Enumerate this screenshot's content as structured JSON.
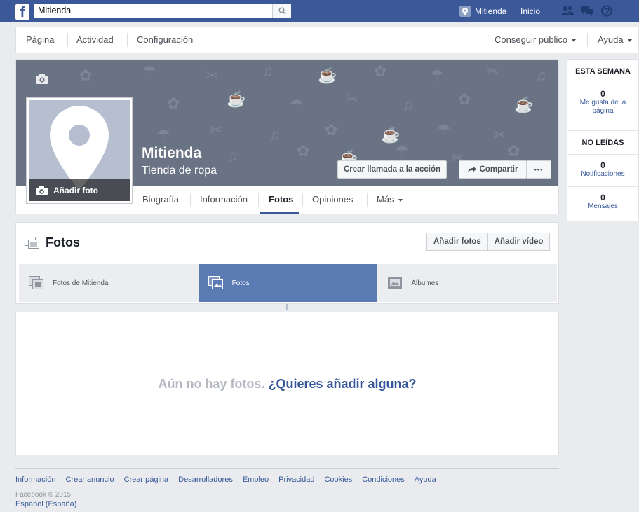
{
  "topbar": {
    "logo": "f",
    "search_value": "Mitienda",
    "page_link": "Mitienda",
    "home": "Inicio",
    "icons": [
      "friends-icon",
      "messages-icon",
      "globe-icon"
    ]
  },
  "pagenav": {
    "left": [
      "Página",
      "Actividad",
      "Configuración"
    ],
    "audience": "Conseguir público",
    "help": "Ayuda"
  },
  "cover": {
    "name": "Mitienda",
    "category": "Tienda de ropa",
    "add_photo": "Añadir foto",
    "cta_button": "Crear llamada a la acción",
    "share_button": "Compartir",
    "more_dots": "•••"
  },
  "tabs": [
    "Biografía",
    "Información",
    "Fotos",
    "Opiniones",
    "Más"
  ],
  "active_tab": "Fotos",
  "rightcol": {
    "week_header": "ESTA SEMANA",
    "likes_count": "0",
    "likes_label": "Me gusta de la página",
    "unread_header": "NO LEÍDAS",
    "notif_count": "0",
    "notif_label": "Notificaciones",
    "msg_count": "0",
    "msg_label": "Mensajes"
  },
  "photos": {
    "title": "Fotos",
    "add_photos": "Añadir fotos",
    "add_video": "Añadir vídeo",
    "subtabs": [
      "Fotos de Mitienda",
      "Fotos",
      "Álbumes"
    ],
    "active_subtab": "Fotos"
  },
  "empty": {
    "gray": "Aún no hay fotos.",
    "link": "¿Quieres añadir alguna?"
  },
  "footer": {
    "links": [
      "Información",
      "Crear anuncio",
      "Crear página",
      "Desarrolladores",
      "Empleo",
      "Privacidad",
      "Cookies",
      "Condiciones",
      "Ayuda"
    ],
    "copyright": "Facebook © 2015",
    "language": "Español (España)"
  },
  "colors": {
    "brand": "#3b5998",
    "cover": "#6a7384",
    "active_subtab": "#5b7bb4",
    "link": "#365899"
  }
}
